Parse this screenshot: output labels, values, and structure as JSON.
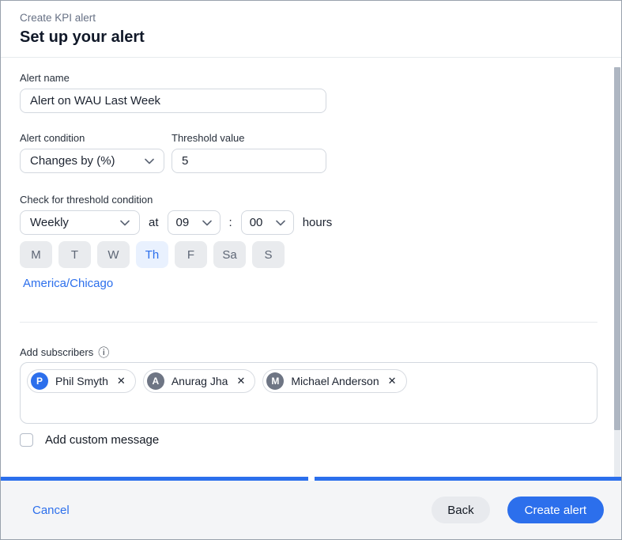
{
  "header": {
    "eyebrow": "Create KPI alert",
    "title": "Set up your alert"
  },
  "form": {
    "alert_name": {
      "label": "Alert name",
      "value": "Alert on WAU Last Week"
    },
    "alert_condition": {
      "label": "Alert condition",
      "value": "Changes by (%)"
    },
    "threshold": {
      "label": "Threshold value",
      "value": "5"
    },
    "check_condition": {
      "label": "Check for threshold condition",
      "frequency": "Weekly",
      "at_label": "at",
      "hour": "09",
      "time_separator": ":",
      "minute": "00",
      "hours_label": "hours",
      "days": [
        {
          "label": "M",
          "selected": false
        },
        {
          "label": "T",
          "selected": false
        },
        {
          "label": "W",
          "selected": false
        },
        {
          "label": "Th",
          "selected": true
        },
        {
          "label": "F",
          "selected": false
        },
        {
          "label": "Sa",
          "selected": false
        },
        {
          "label": "S",
          "selected": false
        }
      ],
      "timezone": "America/Chicago"
    },
    "subscribers": {
      "label": "Add subscribers",
      "chips": [
        {
          "initial": "P",
          "name": "Phil Smyth",
          "color": "#2c6fec"
        },
        {
          "initial": "A",
          "name": "Anurag Jha",
          "color": "#6e7584"
        },
        {
          "initial": "M",
          "name": "Michael Anderson",
          "color": "#6e7584"
        }
      ]
    },
    "custom_message": {
      "label": "Add custom message",
      "checked": false
    }
  },
  "footer": {
    "cancel_label": "Cancel",
    "back_label": "Back",
    "submit_label": "Create alert"
  },
  "icons": {
    "remove": "✕",
    "info": "ⓘ"
  },
  "colors": {
    "accent": "#2c6fec",
    "accent_light_bg": "#e9f1fe",
    "day_bg": "#e9ebee",
    "avatar_gray": "#6e7584",
    "footer_bg": "#f4f5f7"
  }
}
